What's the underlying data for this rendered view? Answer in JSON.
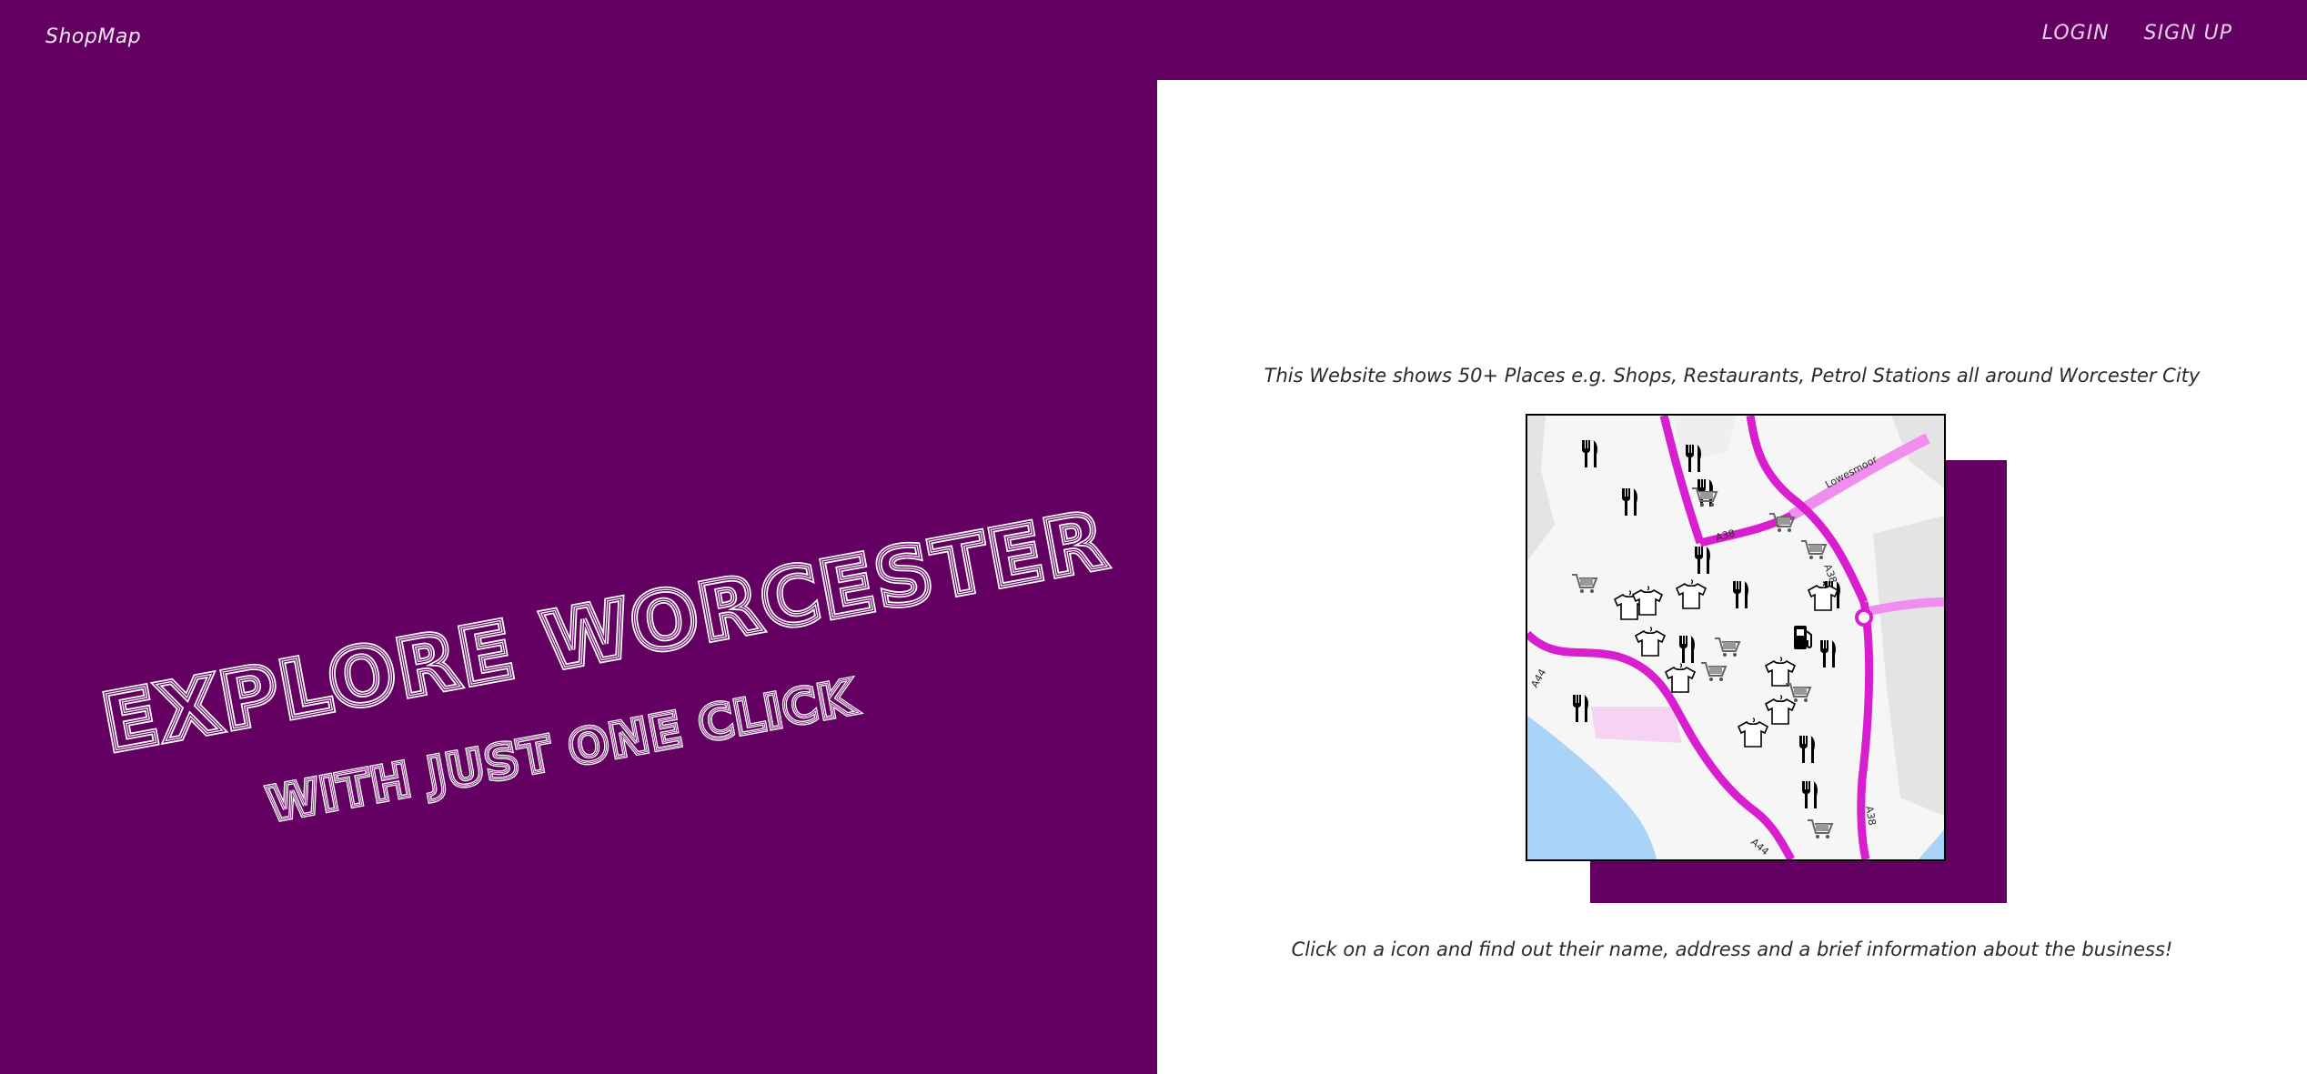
{
  "header": {
    "brand": "ShopMap",
    "nav": {
      "login": "LOGIN",
      "signup": "SIGN UP"
    }
  },
  "hero": {
    "line1": "EXPLORE WORCESTER",
    "line2": "WITH JUST ONE CLICK"
  },
  "intro": {
    "top_text": "This Website shows 50+ Places e.g. Shops, Restaurants, Petrol Stations all around Worcester City",
    "bottom_text": "Click on a icon and find out their name, address and a brief information about the business!"
  },
  "map": {
    "road_labels": [
      "Lowesmoor",
      "A38",
      "A38",
      "A38",
      "A44",
      "A44"
    ],
    "markers": [
      {
        "icon": "restaurant-icon"
      },
      {
        "icon": "restaurant-icon"
      },
      {
        "icon": "restaurant-icon"
      },
      {
        "icon": "restaurant-icon"
      },
      {
        "icon": "restaurant-icon"
      },
      {
        "icon": "restaurant-icon"
      },
      {
        "icon": "restaurant-icon"
      },
      {
        "icon": "restaurant-icon"
      },
      {
        "icon": "restaurant-icon"
      },
      {
        "icon": "restaurant-icon"
      },
      {
        "icon": "restaurant-icon"
      },
      {
        "icon": "restaurant-icon"
      },
      {
        "icon": "clothing-icon"
      },
      {
        "icon": "clothing-icon"
      },
      {
        "icon": "clothing-icon"
      },
      {
        "icon": "clothing-icon"
      },
      {
        "icon": "clothing-icon"
      },
      {
        "icon": "clothing-icon"
      },
      {
        "icon": "clothing-icon"
      },
      {
        "icon": "clothing-icon"
      },
      {
        "icon": "clothing-icon"
      },
      {
        "icon": "shopping-cart-icon"
      },
      {
        "icon": "shopping-cart-icon"
      },
      {
        "icon": "shopping-cart-icon"
      },
      {
        "icon": "shopping-cart-icon"
      },
      {
        "icon": "shopping-cart-icon"
      },
      {
        "icon": "shopping-cart-icon"
      },
      {
        "icon": "shopping-cart-icon"
      },
      {
        "icon": "shopping-cart-icon"
      },
      {
        "icon": "petrol-station-icon"
      }
    ]
  },
  "colors": {
    "brand_purple": "#650063",
    "road_magenta": "#d81ecf",
    "road_light": "#f08ef0",
    "river_blue": "#aad3f8"
  }
}
